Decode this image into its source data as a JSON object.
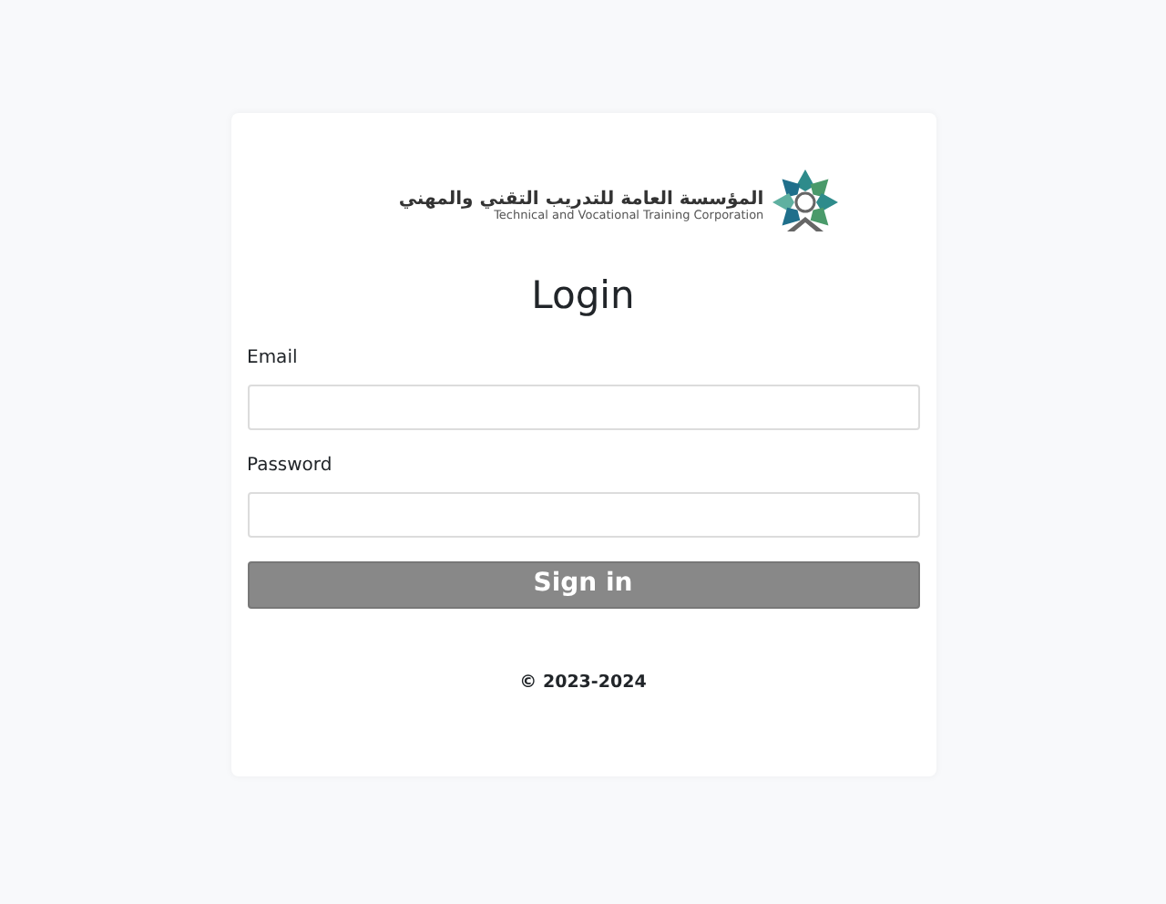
{
  "logo": {
    "arabic_name": "المؤسسة العامة للتدريب التقني والمهني",
    "english_name": "Technical and Vocational Training Corporation"
  },
  "title": "Login",
  "fields": [
    {
      "label": "Email"
    },
    {
      "label": "Password"
    }
  ],
  "button": "Sign in",
  "footer": "© 2023-2024"
}
